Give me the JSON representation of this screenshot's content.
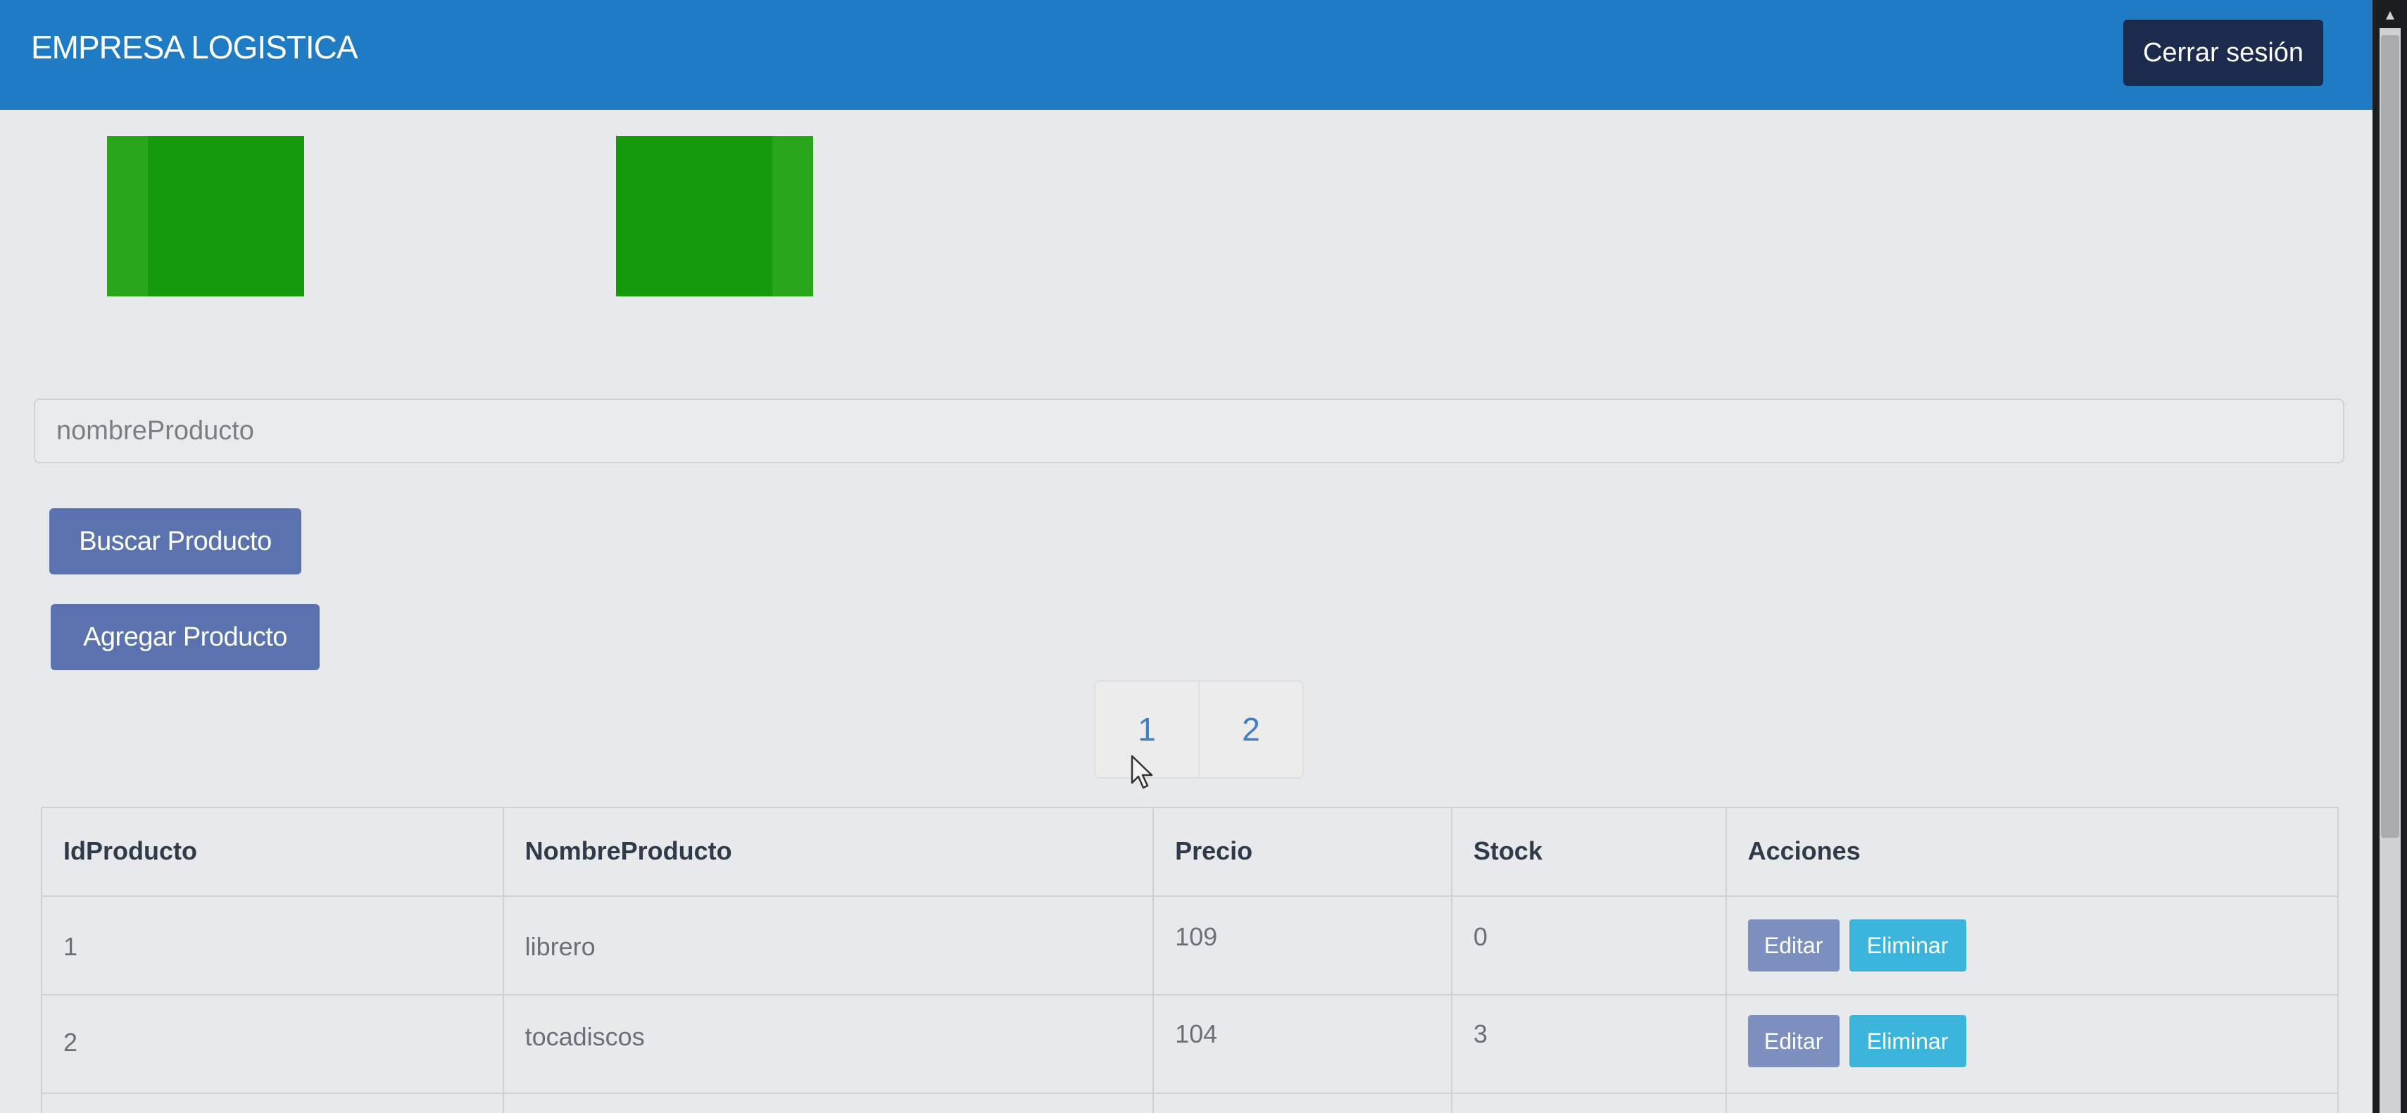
{
  "navbar": {
    "brand": "EMPRESA LOGISTICA",
    "logout_label": "Cerrar sesión"
  },
  "search": {
    "placeholder": "nombreProducto",
    "value": ""
  },
  "buttons": {
    "search_label": "Buscar Producto",
    "add_label": "Agregar Producto"
  },
  "pagination": {
    "pages": [
      "1",
      "2"
    ]
  },
  "table": {
    "columns": [
      "IdProducto",
      "NombreProducto",
      "Precio",
      "Stock",
      "Acciones"
    ],
    "rows": [
      {
        "id": "1",
        "name": "librero",
        "price": "109",
        "stock": "0"
      },
      {
        "id": "2",
        "name": "tocadiscos",
        "price": "104",
        "stock": "3"
      }
    ],
    "edit_label": "Editar",
    "delete_label": "Eliminar"
  },
  "colors": {
    "navbar": "#1f7cc4",
    "logout_button": "#1c2a4e",
    "primary_button": "#5a73ae",
    "edit_button": "#7c8fbf",
    "delete_button": "#3bb5db",
    "banner_green": "#159a0d"
  },
  "icons": {
    "cursor": "mouse-pointer-icon",
    "scroll_up": "chevron-up-icon"
  }
}
